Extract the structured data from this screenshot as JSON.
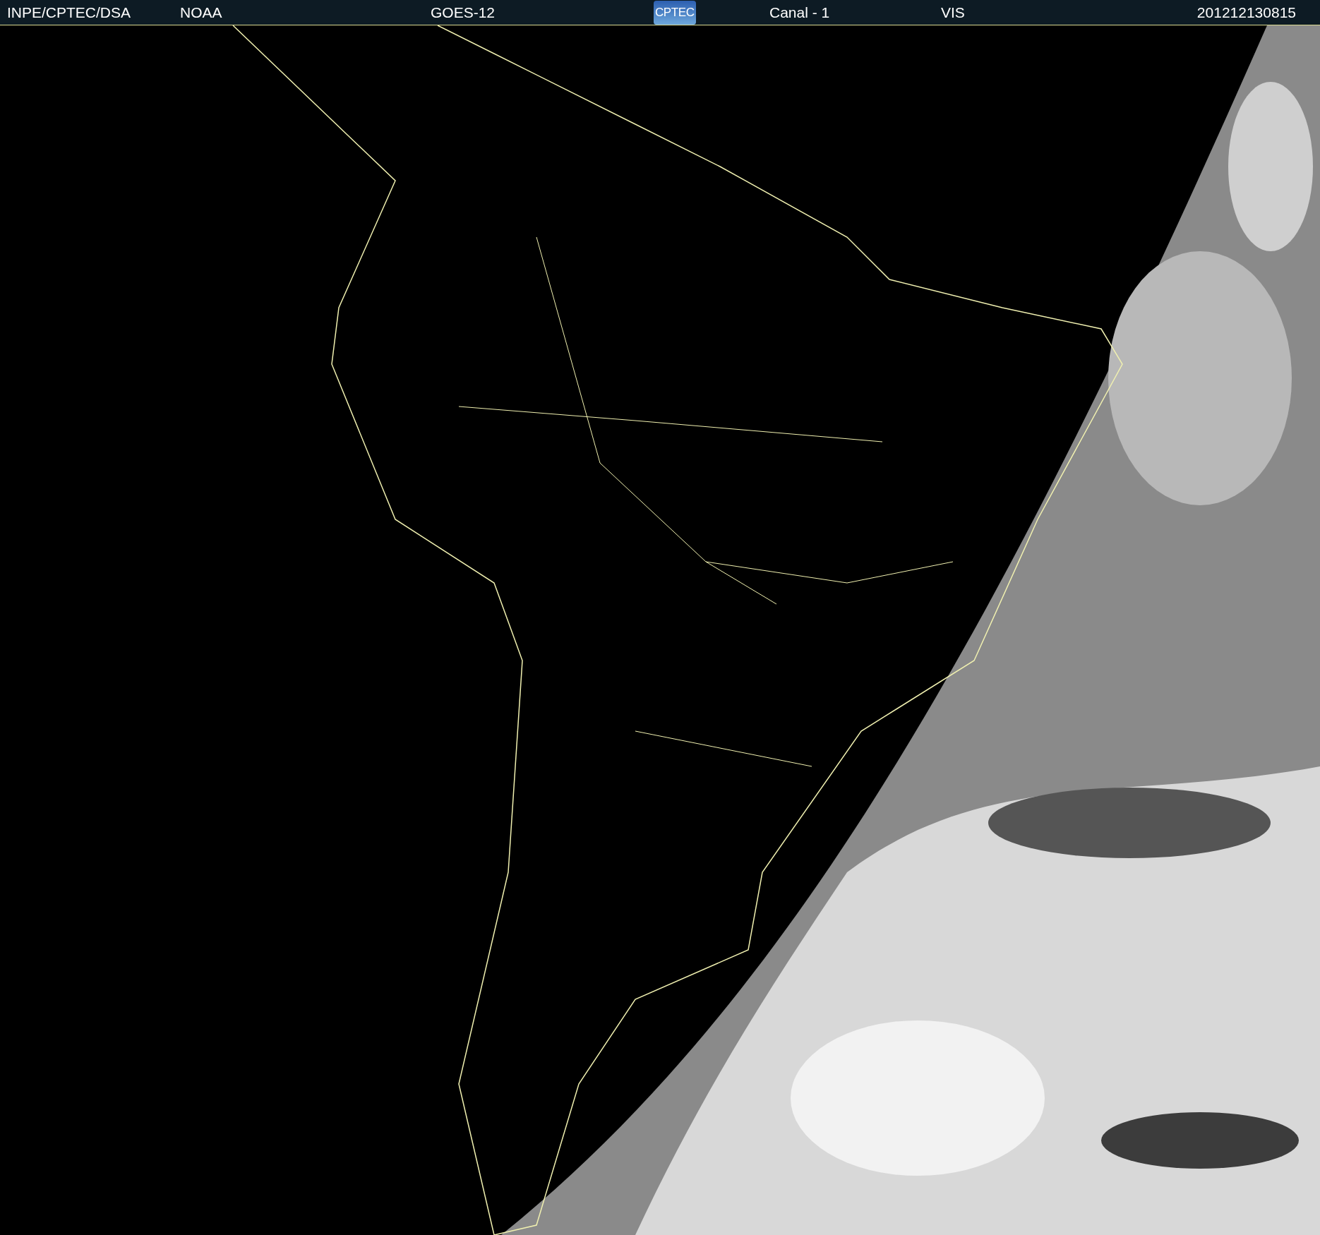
{
  "header": {
    "items": [
      {
        "kind": "text",
        "text": "INPE/CPTEC/DSA"
      },
      {
        "kind": "text",
        "text": "NOAA"
      },
      {
        "kind": "text",
        "text": "GOES-12"
      },
      {
        "kind": "logo",
        "text": "CPTEC"
      },
      {
        "kind": "text",
        "text": "Canal - 1"
      },
      {
        "kind": "text",
        "text": "VIS"
      },
      {
        "kind": "text",
        "text": "201212130815"
      }
    ]
  }
}
